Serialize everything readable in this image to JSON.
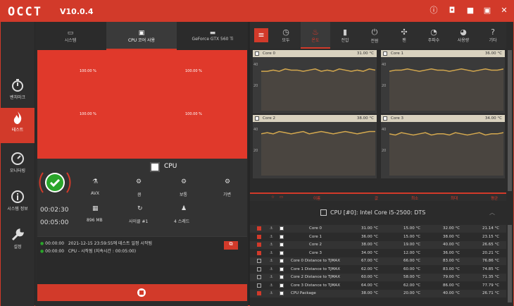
{
  "app": {
    "logo": "OCCT",
    "version": "V10.0.4"
  },
  "titlebar": {
    "icons": [
      "info-icon",
      "camera-icon",
      "minimize-icon",
      "close-icon"
    ]
  },
  "sidebar": [
    {
      "label": "벤치마크",
      "icon": "stopwatch-icon"
    },
    {
      "label": "테스트",
      "icon": "flame-icon"
    },
    {
      "label": "모니터링",
      "icon": "gauge-icon"
    },
    {
      "label": "시스템 정보",
      "icon": "info-circle-icon"
    },
    {
      "label": "설정",
      "icon": "wrench-icon"
    }
  ],
  "left_tabs": [
    {
      "label": "시스템"
    },
    {
      "label": "CPU 코어 사용"
    },
    {
      "label": "GeForce GTX 560 Ti"
    }
  ],
  "core_usage": [
    "100.00 %",
    "100.00 %",
    "100.00 %",
    "100.00 %"
  ],
  "test": {
    "title": "CPU",
    "elapsed": "00:02:30",
    "total": "00:05:00",
    "options": [
      {
        "label": "AVX"
      },
      {
        "label": "큼"
      },
      {
        "label": "보통"
      },
      {
        "label": "가변"
      },
      {
        "label": "896 MB"
      },
      {
        "label": "사이클 #1"
      },
      {
        "label": "4 스레드"
      }
    ]
  },
  "logs": [
    {
      "time": "00:00:00",
      "text": "2021-12-15 23:59:55에 테스트 일정 시작됨"
    },
    {
      "time": "00:00:00",
      "text": "CPU - 시작됨 (지속시간 : 00:05:00)"
    }
  ],
  "right_tabs": [
    {
      "label": "모두"
    },
    {
      "label": "온도"
    },
    {
      "label": "전압"
    },
    {
      "label": "전원"
    },
    {
      "label": "팬"
    },
    {
      "label": "주파수"
    },
    {
      "label": "사용량"
    },
    {
      "label": "기타"
    }
  ],
  "charts": [
    {
      "name": "Core 0",
      "value": "31.00 °C",
      "data": [
        34,
        34,
        35,
        34,
        36,
        35,
        35,
        34,
        35,
        36,
        34,
        35,
        34,
        36,
        35,
        34,
        35,
        34,
        36,
        35
      ]
    },
    {
      "name": "Core 1",
      "value": "36.00 °C",
      "data": [
        34,
        35,
        35,
        36,
        35,
        34,
        35,
        36,
        35,
        35,
        34,
        35,
        36,
        35,
        34,
        35,
        36,
        35,
        35,
        36
      ]
    },
    {
      "name": "Core 2",
      "value": "38.00 °C",
      "data": [
        36,
        37,
        36,
        38,
        37,
        36,
        37,
        38,
        36,
        37,
        38,
        37,
        36,
        37,
        38,
        37,
        36,
        37,
        38,
        38
      ]
    },
    {
      "name": "Core 3",
      "value": "34.00 °C",
      "data": [
        36,
        35,
        37,
        36,
        35,
        36,
        37,
        35,
        36,
        36,
        35,
        37,
        36,
        35,
        36,
        37,
        35,
        36,
        36,
        37
      ]
    }
  ],
  "chart_ticks": {
    "y40": "40",
    "y20": "20"
  },
  "table": {
    "headers": [
      "이름",
      "값",
      "최소",
      "최대",
      "평균"
    ],
    "section": "CPU [#0]: Intel Core i5-2500: DTS",
    "rows": [
      {
        "on": true,
        "name": "Core 0",
        "val": "31.00 °C",
        "min": "15.00 °C",
        "max": "32.00 °C",
        "avg": "21.14 °C"
      },
      {
        "on": true,
        "name": "Core 1",
        "val": "36.00 °C",
        "min": "15.00 °C",
        "max": "38.00 °C",
        "avg": "23.15 °C"
      },
      {
        "on": true,
        "name": "Core 2",
        "val": "38.00 °C",
        "min": "19.00 °C",
        "max": "40.00 °C",
        "avg": "26.65 °C"
      },
      {
        "on": true,
        "name": "Core 3",
        "val": "34.00 °C",
        "min": "12.00 °C",
        "max": "36.00 °C",
        "avg": "20.21 °C"
      },
      {
        "on": false,
        "name": "Core 0 Distance to TjMAX",
        "val": "67.00 °C",
        "min": "66.00 °C",
        "max": "83.00 °C",
        "avg": "76.86 °C"
      },
      {
        "on": false,
        "name": "Core 1 Distance to TjMAX",
        "val": "62.00 °C",
        "min": "60.00 °C",
        "max": "83.00 °C",
        "avg": "74.85 °C"
      },
      {
        "on": false,
        "name": "Core 2 Distance to TjMAX",
        "val": "60.00 °C",
        "min": "58.00 °C",
        "max": "79.00 °C",
        "avg": "71.35 °C"
      },
      {
        "on": false,
        "name": "Core 3 Distance to TjMAX",
        "val": "64.00 °C",
        "min": "62.00 °C",
        "max": "86.00 °C",
        "avg": "77.79 °C"
      },
      {
        "on": true,
        "name": "CPU Package",
        "val": "38.00 °C",
        "min": "20.00 °C",
        "max": "40.00 °C",
        "avg": "26.71 °C"
      }
    ]
  }
}
